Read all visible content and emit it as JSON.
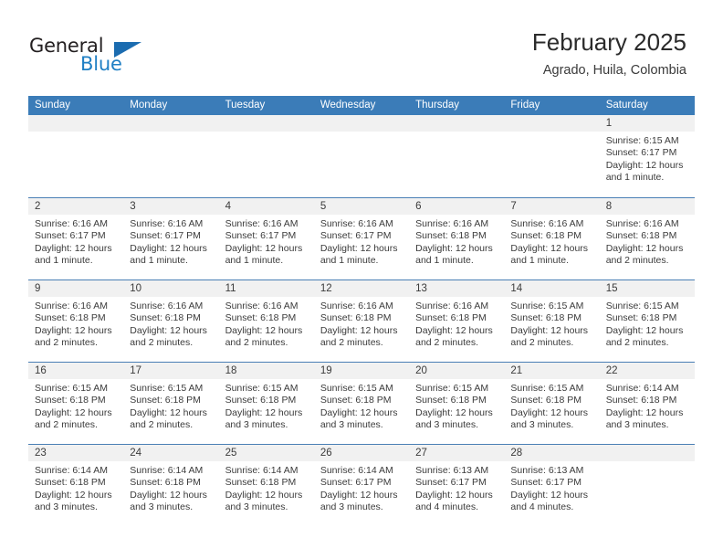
{
  "brand": {
    "name_part1": "General",
    "name_part2": "Blue",
    "flag_icon": "triangle-flag-icon"
  },
  "header": {
    "title": "February 2025",
    "subtitle": "Agrado, Huila, Colombia"
  },
  "colors": {
    "header_blue": "#3b7cb8",
    "brand_blue": "#1f7fc4",
    "numband_gray": "#f1f1f1",
    "text": "#3b3b3b"
  },
  "weekdays": [
    "Sunday",
    "Monday",
    "Tuesday",
    "Wednesday",
    "Thursday",
    "Friday",
    "Saturday"
  ],
  "weeks": [
    [
      {
        "day": "",
        "blank": true
      },
      {
        "day": "",
        "blank": true
      },
      {
        "day": "",
        "blank": true
      },
      {
        "day": "",
        "blank": true
      },
      {
        "day": "",
        "blank": true
      },
      {
        "day": "",
        "blank": true
      },
      {
        "day": "1",
        "sunrise": "Sunrise: 6:15 AM",
        "sunset": "Sunset: 6:17 PM",
        "daylight": "Daylight: 12 hours and 1 minute."
      }
    ],
    [
      {
        "day": "2",
        "sunrise": "Sunrise: 6:16 AM",
        "sunset": "Sunset: 6:17 PM",
        "daylight": "Daylight: 12 hours and 1 minute."
      },
      {
        "day": "3",
        "sunrise": "Sunrise: 6:16 AM",
        "sunset": "Sunset: 6:17 PM",
        "daylight": "Daylight: 12 hours and 1 minute."
      },
      {
        "day": "4",
        "sunrise": "Sunrise: 6:16 AM",
        "sunset": "Sunset: 6:17 PM",
        "daylight": "Daylight: 12 hours and 1 minute."
      },
      {
        "day": "5",
        "sunrise": "Sunrise: 6:16 AM",
        "sunset": "Sunset: 6:17 PM",
        "daylight": "Daylight: 12 hours and 1 minute."
      },
      {
        "day": "6",
        "sunrise": "Sunrise: 6:16 AM",
        "sunset": "Sunset: 6:18 PM",
        "daylight": "Daylight: 12 hours and 1 minute."
      },
      {
        "day": "7",
        "sunrise": "Sunrise: 6:16 AM",
        "sunset": "Sunset: 6:18 PM",
        "daylight": "Daylight: 12 hours and 1 minute."
      },
      {
        "day": "8",
        "sunrise": "Sunrise: 6:16 AM",
        "sunset": "Sunset: 6:18 PM",
        "daylight": "Daylight: 12 hours and 2 minutes."
      }
    ],
    [
      {
        "day": "9",
        "sunrise": "Sunrise: 6:16 AM",
        "sunset": "Sunset: 6:18 PM",
        "daylight": "Daylight: 12 hours and 2 minutes."
      },
      {
        "day": "10",
        "sunrise": "Sunrise: 6:16 AM",
        "sunset": "Sunset: 6:18 PM",
        "daylight": "Daylight: 12 hours and 2 minutes."
      },
      {
        "day": "11",
        "sunrise": "Sunrise: 6:16 AM",
        "sunset": "Sunset: 6:18 PM",
        "daylight": "Daylight: 12 hours and 2 minutes."
      },
      {
        "day": "12",
        "sunrise": "Sunrise: 6:16 AM",
        "sunset": "Sunset: 6:18 PM",
        "daylight": "Daylight: 12 hours and 2 minutes."
      },
      {
        "day": "13",
        "sunrise": "Sunrise: 6:16 AM",
        "sunset": "Sunset: 6:18 PM",
        "daylight": "Daylight: 12 hours and 2 minutes."
      },
      {
        "day": "14",
        "sunrise": "Sunrise: 6:15 AM",
        "sunset": "Sunset: 6:18 PM",
        "daylight": "Daylight: 12 hours and 2 minutes."
      },
      {
        "day": "15",
        "sunrise": "Sunrise: 6:15 AM",
        "sunset": "Sunset: 6:18 PM",
        "daylight": "Daylight: 12 hours and 2 minutes."
      }
    ],
    [
      {
        "day": "16",
        "sunrise": "Sunrise: 6:15 AM",
        "sunset": "Sunset: 6:18 PM",
        "daylight": "Daylight: 12 hours and 2 minutes."
      },
      {
        "day": "17",
        "sunrise": "Sunrise: 6:15 AM",
        "sunset": "Sunset: 6:18 PM",
        "daylight": "Daylight: 12 hours and 2 minutes."
      },
      {
        "day": "18",
        "sunrise": "Sunrise: 6:15 AM",
        "sunset": "Sunset: 6:18 PM",
        "daylight": "Daylight: 12 hours and 3 minutes."
      },
      {
        "day": "19",
        "sunrise": "Sunrise: 6:15 AM",
        "sunset": "Sunset: 6:18 PM",
        "daylight": "Daylight: 12 hours and 3 minutes."
      },
      {
        "day": "20",
        "sunrise": "Sunrise: 6:15 AM",
        "sunset": "Sunset: 6:18 PM",
        "daylight": "Daylight: 12 hours and 3 minutes."
      },
      {
        "day": "21",
        "sunrise": "Sunrise: 6:15 AM",
        "sunset": "Sunset: 6:18 PM",
        "daylight": "Daylight: 12 hours and 3 minutes."
      },
      {
        "day": "22",
        "sunrise": "Sunrise: 6:14 AM",
        "sunset": "Sunset: 6:18 PM",
        "daylight": "Daylight: 12 hours and 3 minutes."
      }
    ],
    [
      {
        "day": "23",
        "sunrise": "Sunrise: 6:14 AM",
        "sunset": "Sunset: 6:18 PM",
        "daylight": "Daylight: 12 hours and 3 minutes."
      },
      {
        "day": "24",
        "sunrise": "Sunrise: 6:14 AM",
        "sunset": "Sunset: 6:18 PM",
        "daylight": "Daylight: 12 hours and 3 minutes."
      },
      {
        "day": "25",
        "sunrise": "Sunrise: 6:14 AM",
        "sunset": "Sunset: 6:18 PM",
        "daylight": "Daylight: 12 hours and 3 minutes."
      },
      {
        "day": "26",
        "sunrise": "Sunrise: 6:14 AM",
        "sunset": "Sunset: 6:17 PM",
        "daylight": "Daylight: 12 hours and 3 minutes."
      },
      {
        "day": "27",
        "sunrise": "Sunrise: 6:13 AM",
        "sunset": "Sunset: 6:17 PM",
        "daylight": "Daylight: 12 hours and 4 minutes."
      },
      {
        "day": "28",
        "sunrise": "Sunrise: 6:13 AM",
        "sunset": "Sunset: 6:17 PM",
        "daylight": "Daylight: 12 hours and 4 minutes."
      },
      {
        "day": "",
        "blank": true
      }
    ]
  ]
}
